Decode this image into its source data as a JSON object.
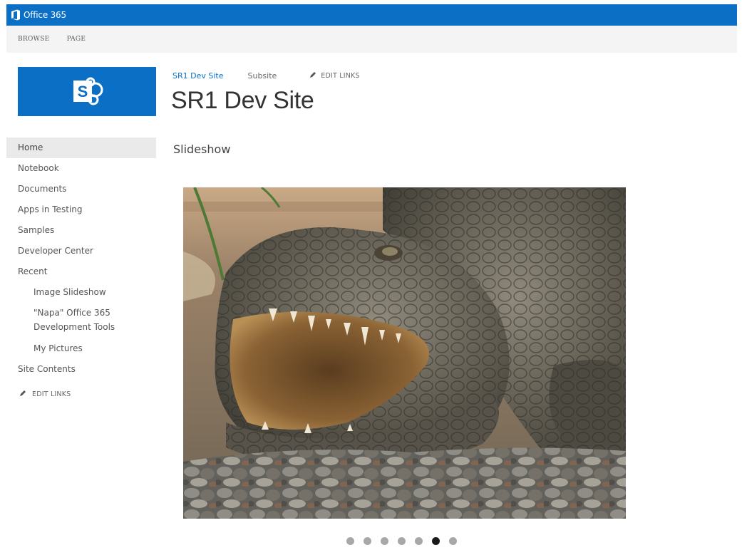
{
  "suite_bar": {
    "brand": "Office 365"
  },
  "ribbon": {
    "tabs": [
      "BROWSE",
      "PAGE"
    ]
  },
  "site_logo": {
    "letter": "S"
  },
  "header": {
    "links": [
      "SR1 Dev Site",
      "Subsite"
    ],
    "edit_links": "EDIT LINKS",
    "title": "SR1 Dev Site"
  },
  "quick_launch": {
    "items": [
      "Home",
      "Notebook",
      "Documents",
      "Apps in Testing",
      "Samples",
      "Developer Center",
      "Recent",
      "Image Slideshow",
      "\"Napa\" Office 365 Development Tools",
      "My Pictures",
      "Site Contents"
    ],
    "edit_links": "EDIT LINKS"
  },
  "main": {
    "heading": "Slideshow",
    "slide_count": 7,
    "active_slide": 6
  },
  "colors": {
    "brand_blue": "#0b6fc6",
    "ribbon_bg": "#f4f4f4",
    "active_nav_bg": "#eaeaea",
    "dot_inactive": "#a8a8a8",
    "dot_active": "#1a1a1a"
  }
}
